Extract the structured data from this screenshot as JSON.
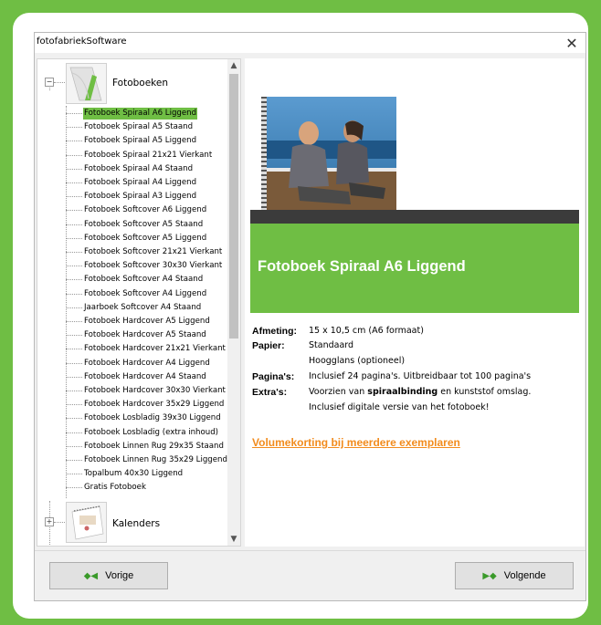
{
  "window": {
    "title": "fotofabriekSoftware",
    "close_symbol": "✕"
  },
  "tree": {
    "categories": [
      {
        "label": "Fotoboeken",
        "expander": "−"
      },
      {
        "label": "Kalenders",
        "expander": "+"
      }
    ],
    "items": [
      "Fotoboek Spiraal A6 Liggend",
      "Fotoboek Spiraal A5 Staand",
      "Fotoboek Spiraal A5 Liggend",
      "Fotoboek Spiraal 21x21 Vierkant",
      "Fotoboek Spiraal A4 Staand",
      "Fotoboek Spiraal A4 Liggend",
      "Fotoboek Spiraal A3 Liggend",
      "Fotoboek Softcover A6 Liggend",
      "Fotoboek Softcover A5 Staand",
      "Fotoboek Softcover A5 Liggend",
      "Fotoboek Softcover 21x21 Vierkant",
      "Fotoboek Softcover 30x30 Vierkant",
      "Fotoboek Softcover A4 Staand",
      "Fotoboek Softcover A4 Liggend",
      "Jaarboek Softcover A4 Staand",
      "Fotoboek Hardcover A5 Liggend",
      "Fotoboek Hardcover A5 Staand",
      "Fotoboek Hardcover 21x21 Vierkant",
      "Fotoboek Hardcover A4 Liggend",
      "Fotoboek Hardcover A4 Staand",
      "Fotoboek Hardcover 30x30 Vierkant",
      "Fotoboek Hardcover 35x29 Liggend",
      "Fotoboek Losbladig 39x30 Liggend",
      "Fotoboek Losbladig (extra inhoud)",
      "Fotoboek Linnen Rug 29x35 Staand",
      "Fotoboek Linnen Rug 35x29 Liggend",
      "Topalbum 40x30 Liggend",
      "Gratis Fotoboek"
    ],
    "selected_index": 0
  },
  "detail": {
    "title": "Fotoboek Spiraal A6 Liggend",
    "specs": {
      "afmeting_key": "Afmeting:",
      "afmeting_val": "15 x 10,5 cm (A6 formaat)",
      "papier_key": "Papier:",
      "papier_val1": "Standaard",
      "papier_val2": "Hoogglans (optioneel)",
      "paginas_key": "Pagina's:",
      "paginas_val": "Inclusief 24 pagina's. Uitbreidbaar tot 100 pagina's",
      "extras_key": "Extra's:",
      "extras_val_pre": "Voorzien van ",
      "extras_val_bold": "spiraalbinding",
      "extras_val_post": " en kunststof omslag.",
      "extras_val2": "Inclusief digitale versie van het fotoboek!"
    },
    "link": "Volumekorting bij meerdere exemplaren"
  },
  "footer": {
    "prev_label": "Vorige",
    "next_label": "Volgende"
  },
  "colors": {
    "accent": "#6fbe44",
    "link": "#f28c1e",
    "dark_bar": "#3b3b3b"
  }
}
